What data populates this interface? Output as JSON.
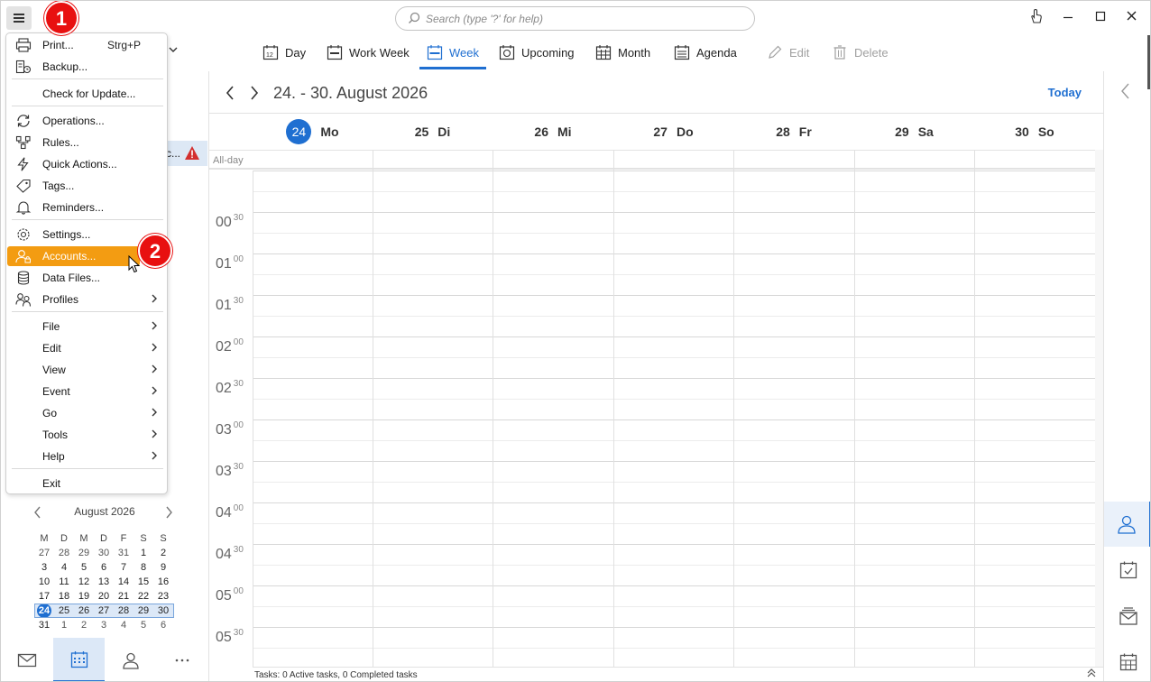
{
  "search": {
    "placeholder": "Search (type '?' for help)"
  },
  "toolbar": {
    "day": "Day",
    "work_week": "Work Week",
    "week": "Week",
    "upcoming": "Upcoming",
    "month": "Month",
    "agenda": "Agenda",
    "edit": "Edit",
    "delete": "Delete"
  },
  "menu": {
    "items": [
      {
        "label": "Print...",
        "shortcut": "Strg+P",
        "icon": "printer-icon"
      },
      {
        "label": "Backup...",
        "icon": "backup-icon"
      },
      {
        "label": "Check for Update..."
      },
      {
        "label": "Operations...",
        "icon": "sync-icon"
      },
      {
        "label": "Rules...",
        "icon": "rules-icon"
      },
      {
        "label": "Quick Actions...",
        "icon": "lightning-icon"
      },
      {
        "label": "Tags...",
        "icon": "tag-icon"
      },
      {
        "label": "Reminders...",
        "icon": "bell-icon"
      },
      {
        "label": "Settings...",
        "icon": "gear-icon"
      },
      {
        "label": "Accounts...",
        "icon": "accounts-icon",
        "highlighted": true
      },
      {
        "label": "Data Files...",
        "icon": "database-icon"
      },
      {
        "label": "Profiles",
        "icon": "profiles-icon",
        "submenu": true
      },
      {
        "label": "File",
        "submenu": true
      },
      {
        "label": "Edit",
        "submenu": true
      },
      {
        "label": "View",
        "submenu": true
      },
      {
        "label": "Event",
        "submenu": true
      },
      {
        "label": "Go",
        "submenu": true
      },
      {
        "label": "Tools",
        "submenu": true
      },
      {
        "label": "Help",
        "submenu": true
      },
      {
        "label": "Exit"
      }
    ]
  },
  "annotations": {
    "step1": "1",
    "step2": "2"
  },
  "left_pane": {
    "truncated_item": "c..."
  },
  "mini_calendar": {
    "title": "August 2026",
    "weekdays": [
      "M",
      "D",
      "M",
      "D",
      "F",
      "S",
      "S"
    ],
    "weeks": [
      [
        "27",
        "28",
        "29",
        "30",
        "31",
        "1",
        "2"
      ],
      [
        "3",
        "4",
        "5",
        "6",
        "7",
        "8",
        "9"
      ],
      [
        "10",
        "11",
        "12",
        "13",
        "14",
        "15",
        "16"
      ],
      [
        "17",
        "18",
        "19",
        "20",
        "21",
        "22",
        "23"
      ],
      [
        "24",
        "25",
        "26",
        "27",
        "28",
        "29",
        "30"
      ],
      [
        "31",
        "1",
        "2",
        "3",
        "4",
        "5",
        "6"
      ]
    ],
    "today": "24"
  },
  "calendar": {
    "range": "24. - 30. August 2026",
    "today_label": "Today",
    "allday_label": "All-day",
    "days": [
      {
        "num": "24",
        "name": "Mo",
        "today": true
      },
      {
        "num": "25",
        "name": "Di"
      },
      {
        "num": "26",
        "name": "Mi"
      },
      {
        "num": "27",
        "name": "Do"
      },
      {
        "num": "28",
        "name": "Fr"
      },
      {
        "num": "29",
        "name": "Sa"
      },
      {
        "num": "30",
        "name": "So"
      }
    ],
    "time_labels": [
      {
        "h": "00",
        "m": "30"
      },
      {
        "h": "01",
        "m": "00"
      },
      {
        "h": "01",
        "m": "30"
      },
      {
        "h": "02",
        "m": "00"
      },
      {
        "h": "02",
        "m": "30"
      },
      {
        "h": "03",
        "m": "00"
      },
      {
        "h": "03",
        "m": "30"
      },
      {
        "h": "04",
        "m": "00"
      },
      {
        "h": "04",
        "m": "30"
      },
      {
        "h": "05",
        "m": "00"
      },
      {
        "h": "05",
        "m": "30"
      }
    ],
    "status": "Tasks: 0 Active tasks, 0 Completed tasks"
  },
  "colors": {
    "accent": "#1f6fd1",
    "highlight": "#f39c12",
    "badge": "#e81010"
  }
}
